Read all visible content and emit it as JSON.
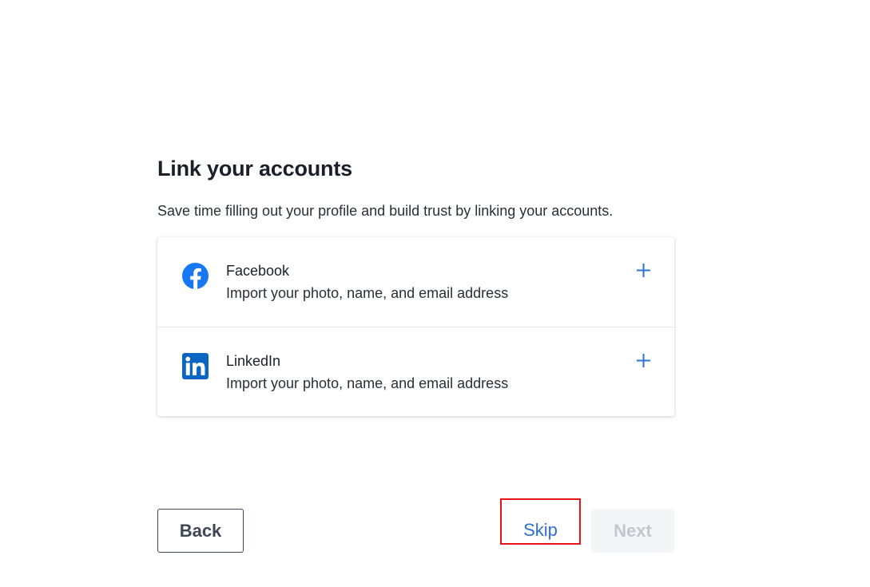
{
  "header": {
    "title": "Link your accounts",
    "subtitle": "Save time filling out your profile and build trust by linking your accounts."
  },
  "accounts": [
    {
      "name": "Facebook",
      "description": "Import your photo, name, and email address",
      "icon": "facebook-icon",
      "color": "#1877f2"
    },
    {
      "name": "LinkedIn",
      "description": "Import your photo, name, and email address",
      "icon": "linkedin-icon",
      "color": "#0a66c2"
    }
  ],
  "footer": {
    "back_label": "Back",
    "skip_label": "Skip",
    "next_label": "Next"
  },
  "colors": {
    "accent": "#2f6fd8",
    "highlight_box": "#e8141a",
    "disabled_bg": "#f4f5f7",
    "disabled_text": "#c2c6cd"
  }
}
